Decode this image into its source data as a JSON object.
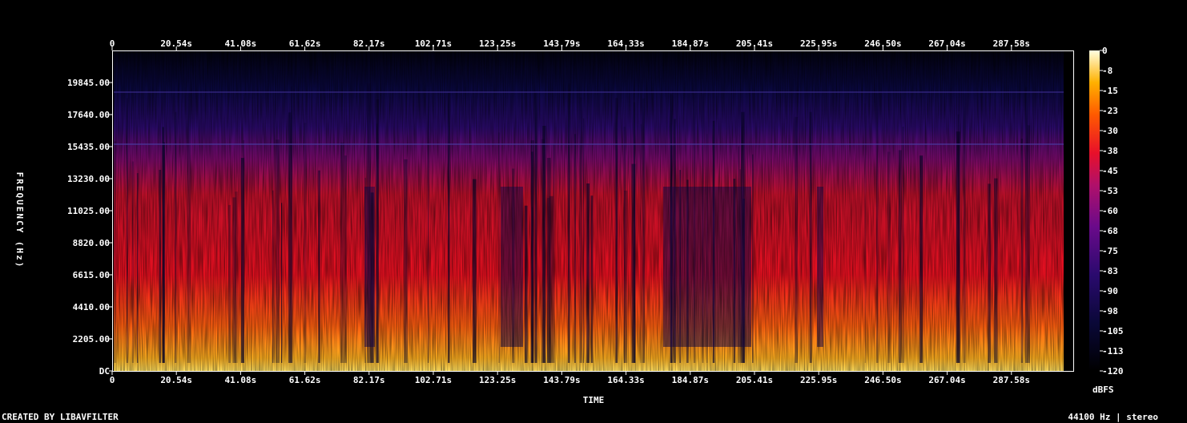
{
  "chart_data": {
    "type": "heatmap",
    "title": "",
    "xlabel": "TIME",
    "ylabel": "FREQUENCY (Hz)",
    "x_ticks": [
      "0",
      "20.54s",
      "41.08s",
      "61.62s",
      "82.17s",
      "102.71s",
      "123.25s",
      "143.79s",
      "164.33s",
      "184.87s",
      "205.41s",
      "225.95s",
      "246.50s",
      "267.04s",
      "287.58s"
    ],
    "y_ticks": [
      "DC",
      "2205.00",
      "4410.00",
      "6615.00",
      "8820.00",
      "11025.00",
      "13230.00",
      "15435.00",
      "17640.00",
      "19845.00"
    ],
    "xlim": [
      0,
      300
    ],
    "ylim": [
      0,
      22050
    ],
    "colorbar": {
      "label": "dBFS",
      "ticks": [
        "0",
        "-8",
        "-15",
        "-23",
        "-30",
        "-38",
        "-45",
        "-53",
        "-60",
        "-68",
        "-75",
        "-83",
        "-90",
        "-98",
        "-105",
        "-113",
        "-120"
      ],
      "range": [
        -120,
        0
      ]
    },
    "colormap": "intensity"
  },
  "footer": {
    "left": "CREATED BY LIBAVFILTER",
    "right": "44100 Hz | stereo"
  }
}
